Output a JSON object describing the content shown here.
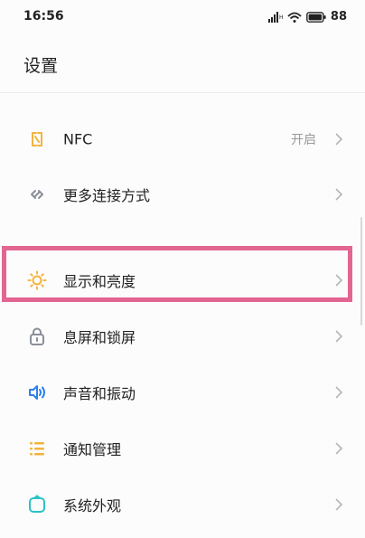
{
  "status_bar": {
    "time": "16:56",
    "battery": "88",
    "icons": [
      "signal-icon",
      "wifi-icon",
      "battery-icon"
    ]
  },
  "header": {
    "title": "设置"
  },
  "items": [
    {
      "id": "nfc",
      "label": "NFC",
      "value": "开启",
      "icon": "nfc-icon",
      "icon_color": "#f2b33d"
    },
    {
      "id": "more-connections",
      "label": "更多连接方式",
      "icon": "link-icon",
      "icon_color": "#8a8f99"
    },
    {
      "id": "display-brightness",
      "label": "显示和亮度",
      "icon": "sun-icon",
      "icon_color": "#f2b33d"
    },
    {
      "id": "lock-screen",
      "label": "息屏和锁屏",
      "icon": "lock-icon",
      "icon_color": "#8a8f99"
    },
    {
      "id": "sound-vibration",
      "label": "声音和振动",
      "icon": "speaker-icon",
      "icon_color": "#2d7ff0"
    },
    {
      "id": "notifications",
      "label": "通知管理",
      "icon": "list-icon",
      "icon_color": "#f2b33d"
    },
    {
      "id": "appearance",
      "label": "系统外观",
      "icon": "appearance-icon",
      "icon_color": "#2ac2c8"
    }
  ],
  "highlight_color": "#e26592"
}
